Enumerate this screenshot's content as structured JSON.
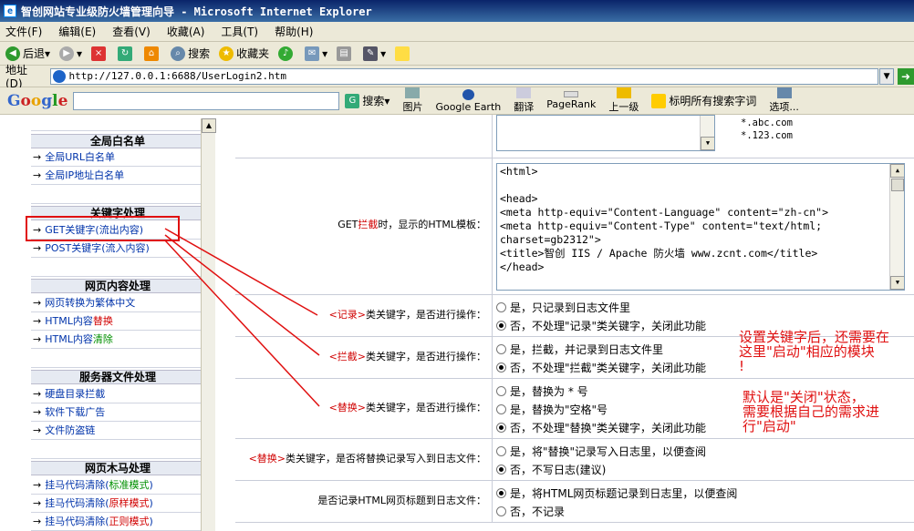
{
  "window": {
    "title": "智创网站专业级防火墙管理向导 - Microsoft Internet Explorer"
  },
  "menu": [
    "文件(F)",
    "编辑(E)",
    "查看(V)",
    "收藏(A)",
    "工具(T)",
    "帮助(H)"
  ],
  "toolbar": {
    "back": "后退",
    "search": "搜索",
    "favorites": "收藏夹"
  },
  "address": {
    "label": "地址(D)",
    "url": "http://127.0.0.1:6688/UserLogin2.htm"
  },
  "googlebar": {
    "logo": "Google",
    "search": "搜索",
    "images": "图片",
    "earth": "Google Earth",
    "translate": "翻译",
    "pagerank": "PageRank",
    "up": "上一级",
    "highlight": "标明所有搜索字词",
    "options": "选项..."
  },
  "sidebar": {
    "sections": [
      {
        "title": "全局白名单",
        "items": [
          "全局URL白名单",
          "全局IP地址白名单"
        ]
      },
      {
        "title": "关键字处理",
        "items": [
          "GET关键字(流出内容)",
          "POST关键字(流入内容)"
        ]
      },
      {
        "title": "网页内容处理",
        "items": [
          "网页转换为繁体中文",
          "HTML内容替换",
          "HTML内容清除"
        ]
      },
      {
        "title": "服务器文件处理",
        "items": [
          "硬盘目录拦截",
          "软件下载广告",
          "文件防盗链"
        ]
      },
      {
        "title": "网页木马处理",
        "items": [
          "挂马代码清除(标准模式)",
          "挂马代码清除(原样模式)",
          "挂马代码清除(正则模式)"
        ]
      }
    ]
  },
  "form": {
    "domain_list": [
      "*.abc.com",
      "*.123.com"
    ],
    "template": {
      "label_pre": "GET",
      "label_red": "拦截",
      "label_post": "时，显示的HTML模板：",
      "lines": [
        "<html>",
        "",
        "<head>",
        "<meta http-equiv=\"Content-Language\" content=\"zh-cn\">",
        "<meta http-equiv=\"Content-Type\" content=\"text/html;",
        "charset=gb2312\">",
        "<title>智创 IIS / Apache 防火墙 www.zcnt.com</title>",
        "</head>"
      ]
    },
    "record": {
      "red": "<记录>",
      "label": "类关键字，是否进行操作：",
      "options": [
        "是，只记录到日志文件里",
        "否，不处理\"记录\"类关键字，关闭此功能"
      ],
      "selected": 1
    },
    "block": {
      "red": "<拦截>",
      "label": "类关键字，是否进行操作：",
      "options": [
        "是，拦截，并记录到日志文件里",
        "否，不处理\"拦截\"类关键字，关闭此功能"
      ],
      "selected": 1
    },
    "replace": {
      "red": "<替换>",
      "label": "类关键字，是否进行操作：",
      "options": [
        "是，替换为 * 号",
        "是，替换为\"空格\"号",
        "否，不处理\"替换\"类关键字，关闭此功能"
      ],
      "selected": 2
    },
    "replace_log": {
      "red": "<替换>",
      "label": "类关键字，是否将替换记录写入到日志文件：",
      "options": [
        "是，将\"替换\"记录写入日志里，以便查阅",
        "否，不写日志(建议)"
      ],
      "selected": 1
    },
    "title_log": {
      "label": "是否记录HTML网页标题到日志文件：",
      "options": [
        "是，将HTML网页标题记录到日志里，以便查阅",
        "否，不记录"
      ],
      "selected": 0
    }
  },
  "annotations": {
    "note1": [
      "设置关键字后，还需要在",
      "这里\"启动\"相应的模块",
      "!"
    ],
    "note2": [
      "默认是\"关闭\"状态，",
      "需要根据自己的需求进",
      "行\"启动\""
    ]
  }
}
